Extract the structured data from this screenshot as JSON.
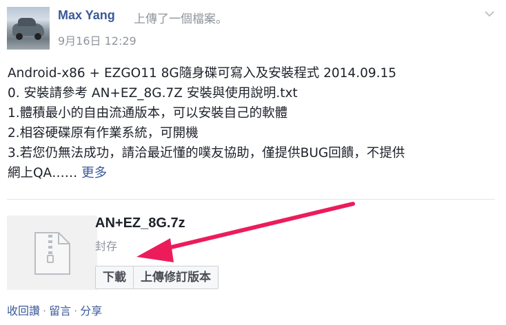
{
  "post": {
    "author": "Max Yang",
    "action": "上傳了一個檔案。",
    "timestamp": "9月16日 12:29",
    "body_lines": [
      "Android-x86 + EZGO11 8G隨身碟可寫入及安裝程式 2014.09.15",
      "0. 安裝請參考 AN+EZ_8G.7Z 安裝與使用說明.txt",
      "1.體積最小的自由流通版本，可以安裝自己的軟體",
      "2.相容硬碟原有作業系統，可開機",
      "3.若您仍無法成功，請洽最近懂的噗友協助，僅提供BUG回饋，不提供",
      "網上QA……"
    ],
    "more_label": "更多"
  },
  "attachment": {
    "file_name": "AN+EZ_8G.7z",
    "file_type": "封存",
    "download_label": "下載",
    "upload_revision_label": "上傳修訂版本",
    "icon": "zip-file-icon"
  },
  "actions": {
    "unfollow": "收回讚",
    "comment": "留言",
    "share": "分享",
    "separator": "·"
  },
  "colors": {
    "link": "#3b5998",
    "meta": "#90949c",
    "arrow": "#ec1c5b"
  },
  "menu_icon": "chevron-down-icon"
}
